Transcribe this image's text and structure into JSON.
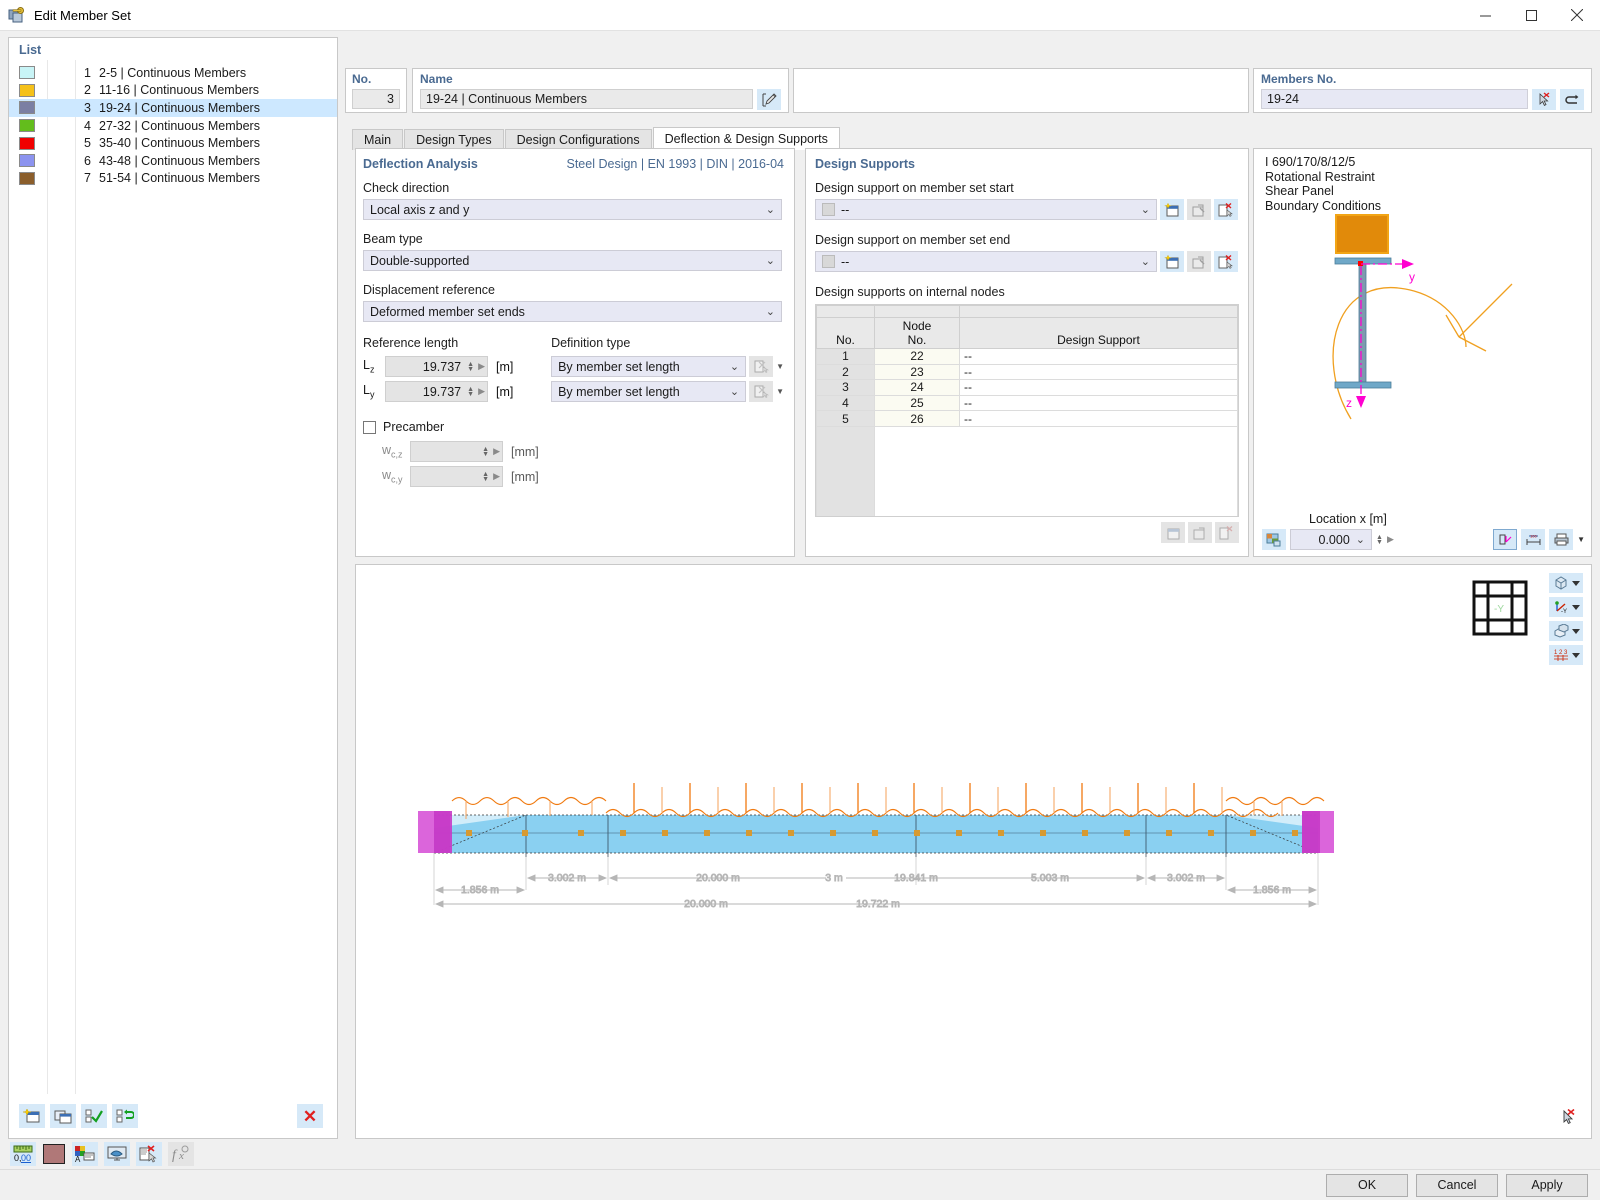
{
  "window": {
    "title": "Edit Member Set",
    "icon": "member-set-icon",
    "minimize": "–",
    "maximize": "☐",
    "close": "✕"
  },
  "list_panel": {
    "header": "List",
    "items": [
      {
        "no": "1",
        "label": "2-5 | Continuous Members",
        "color": "#c8f4f6"
      },
      {
        "no": "2",
        "label": "11-16 | Continuous Members",
        "color": "#f5c11a"
      },
      {
        "no": "3",
        "label": "19-24 | Continuous Members",
        "color": "#7b7fa3",
        "selected": true
      },
      {
        "no": "4",
        "label": "27-32 | Continuous Members",
        "color": "#63bd1c"
      },
      {
        "no": "5",
        "label": "35-40 | Continuous Members",
        "color": "#f00000"
      },
      {
        "no": "6",
        "label": "43-48 | Continuous Members",
        "color": "#8c93ef"
      },
      {
        "no": "7",
        "label": "51-54 | Continuous Members",
        "color": "#8b5e2b"
      }
    ],
    "toolbar": {
      "new": "new-icon",
      "copy": "copy-icon",
      "check_all": "check-all-icon",
      "invert": "invert-selection-icon",
      "delete": "✕"
    }
  },
  "header": {
    "no_label": "No.",
    "no_value": "3",
    "name_label": "Name",
    "name_value": "19-24 | Continuous Members",
    "name_edit_icon": "edit-icon",
    "members_label": "Members No.",
    "members_value": "19-24",
    "members_pick_icon": "pick-cursor-icon",
    "members_reverse_icon": "reverse-arrow-icon"
  },
  "tabs": [
    {
      "label": "Main",
      "active": false
    },
    {
      "label": "Design Types",
      "active": false
    },
    {
      "label": "Design Configurations",
      "active": false
    },
    {
      "label": "Deflection & Design Supports",
      "active": true
    }
  ],
  "deflection": {
    "title": "Deflection Analysis",
    "standard": "Steel Design | EN 1993 | DIN | 2016-04",
    "check_direction_label": "Check direction",
    "check_direction_value": "Local axis z and y",
    "beam_type_label": "Beam type",
    "beam_type_value": "Double-supported",
    "displacement_reference_label": "Displacement reference",
    "displacement_reference_value": "Deformed member set ends",
    "reference_length_label": "Reference length",
    "definition_type_label": "Definition type",
    "rows": [
      {
        "symbol": "L",
        "sub": "z",
        "value": "19.737",
        "unit": "[m]",
        "definition": "By member set length"
      },
      {
        "symbol": "L",
        "sub": "y",
        "value": "19.737",
        "unit": "[m]",
        "definition": "By member set length"
      }
    ],
    "precamber_label": "Precamber",
    "precamber_checked": false,
    "precamber_rows": [
      {
        "symbol": "w",
        "sub": "c,z",
        "value": "",
        "unit": "[mm]"
      },
      {
        "symbol": "w",
        "sub": "c,y",
        "value": "",
        "unit": "[mm]"
      }
    ]
  },
  "design_supports": {
    "title": "Design Supports",
    "start_label": "Design support on member set start",
    "start_value": "--",
    "end_label": "Design support on member set end",
    "end_value": "--",
    "internal_label": "Design supports on internal nodes",
    "row_icons": {
      "new": "new-icon",
      "edit": "edit-icon",
      "delete": "delete-icon"
    },
    "table": {
      "columns": [
        "No.",
        "Node No.",
        "Design Support"
      ],
      "rows": [
        {
          "no": "1",
          "node": "22",
          "support": "--"
        },
        {
          "no": "2",
          "node": "23",
          "support": "--"
        },
        {
          "no": "3",
          "node": "24",
          "support": "--"
        },
        {
          "no": "4",
          "node": "25",
          "support": "--"
        },
        {
          "no": "5",
          "node": "26",
          "support": "--"
        }
      ]
    }
  },
  "preview": {
    "lines": [
      "I 690/170/8/12/5",
      "Rotational Restraint",
      "Shear Panel",
      "Boundary Conditions"
    ],
    "axis_y": "y",
    "axis_z": "z",
    "location_label": "Location x [m]",
    "location_value": "0.000",
    "render_icon": "render-mode-icon",
    "axes_icon": "axes-icon",
    "dimension_icon": "dimension-icon",
    "print_icon": "print-icon",
    "colors": {
      "panel": "#e18a0a",
      "section": "#7e9aae",
      "flange": "#6fa8c8",
      "axis": "#ff00d0"
    }
  },
  "graphics": {
    "view_buttons": [
      {
        "name": "render-mode-button",
        "icon": "cube-icon"
      },
      {
        "name": "view-direction-button",
        "icon": "axes-xyz-icon",
        "label": "-Y"
      },
      {
        "name": "section-view-button",
        "icon": "slab-icon"
      },
      {
        "name": "numbering-button",
        "icon": "numbering-icon"
      }
    ],
    "nav_cube_label": "-Y",
    "clear_icon": "clear-selection-icon",
    "dimensions_upper": [
      "1.856 m",
      "3.002 m",
      "20.000 m",
      "3 m",
      "19.841 m",
      "5.003 m",
      "3.002 m",
      "1.856 m"
    ],
    "dimensions_lower": [
      "20.000 m",
      "19.722 m"
    ],
    "colors": {
      "member": "#7ecbf0",
      "support": "#d23fd2",
      "load": "#f07a10",
      "dimension": "#b6b6b6",
      "node": "#d79a31"
    }
  },
  "bottom_toolbar": [
    {
      "name": "units-button",
      "icon": "ruler-number-icon"
    },
    {
      "name": "color-swatch",
      "icon": "color-swatch-icon",
      "color": "#b07878"
    },
    {
      "name": "display-props-button",
      "icon": "display-properties-icon"
    },
    {
      "name": "view-settings-button",
      "icon": "monitor-icon"
    },
    {
      "name": "comment-button",
      "icon": "comment-delete-icon"
    },
    {
      "name": "formula-button",
      "icon": "formula-icon",
      "disabled": true
    }
  ],
  "dialog_buttons": {
    "ok": "OK",
    "cancel": "Cancel",
    "apply": "Apply"
  }
}
